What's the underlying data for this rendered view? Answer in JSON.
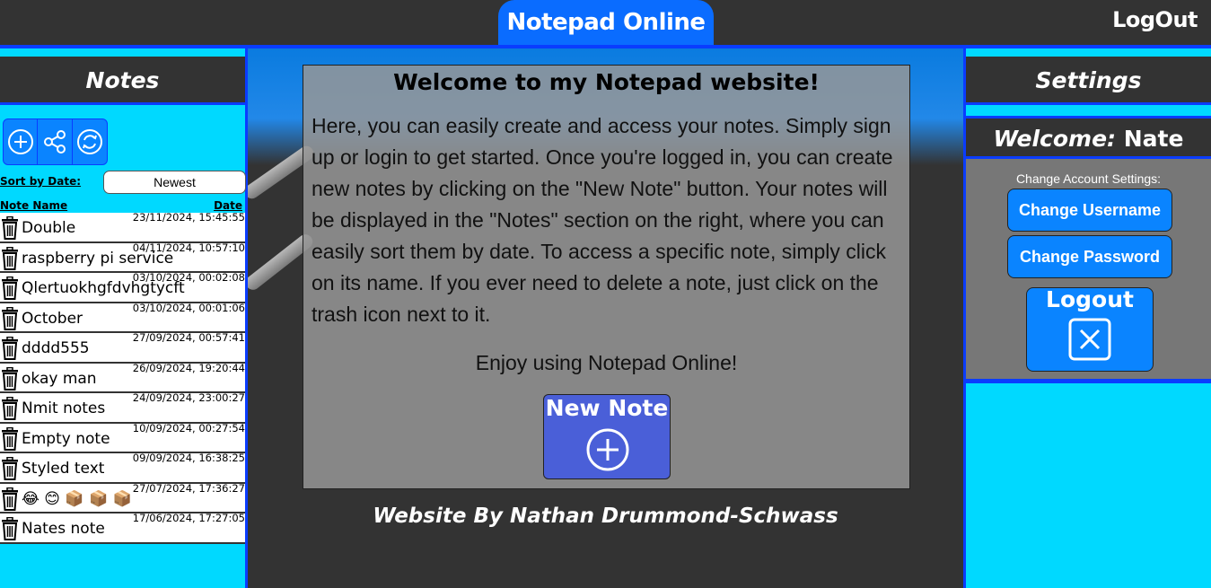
{
  "header": {
    "site_title": "Notepad Online",
    "logout_label": "LogOut"
  },
  "notes_panel": {
    "title": "Notes",
    "tools": [
      {
        "icon": "add-circle-icon"
      },
      {
        "icon": "share-icon"
      },
      {
        "icon": "refresh-icon"
      }
    ],
    "sort_label": "Sort by Date:",
    "sort_value": "Newest",
    "col_name": "Note Name",
    "col_date": "Date",
    "notes": [
      {
        "name": "Double",
        "date": "23/11/2024, 15:45:55"
      },
      {
        "name": "raspberry pi service",
        "date": "04/11/2024, 10:57:10"
      },
      {
        "name": "Qlertuokhgfdvhgtycft",
        "date": "03/10/2024, 00:02:08"
      },
      {
        "name": "October",
        "date": "03/10/2024, 00:01:06"
      },
      {
        "name": "dddd555",
        "date": "27/09/2024, 00:57:41"
      },
      {
        "name": "okay man",
        "date": "26/09/2024, 19:20:44"
      },
      {
        "name": "Nmit notes",
        "date": "24/09/2024, 23:00:27"
      },
      {
        "name": "Empty note",
        "date": "10/09/2024, 00:27:54"
      },
      {
        "name": "Styled text",
        "date": "09/09/2024, 16:38:25"
      },
      {
        "name": "😂 😊 📦 📦 📦",
        "date": "27/07/2024, 17:36:27"
      },
      {
        "name": "Nates note",
        "date": "17/06/2024, 17:27:05"
      }
    ]
  },
  "main": {
    "welcome_title": "Welcome to my Notepad website!",
    "welcome_text": "Here, you can easily create and access your notes. Simply sign up or login to get started. Once you're logged in, you can create new notes by clicking on the \"New Note\" button. Your notes will be displayed in the \"Notes\" section on the right, where you can easily sort them by date. To access a specific note, simply click on its name. If you ever need to delete a note, just click on the trash icon next to it.",
    "enjoy_text": "Enjoy using Notepad Online!",
    "new_note_label": "New Note",
    "footer": "Website By Nathan Drummond-Schwass"
  },
  "settings_panel": {
    "title": "Settings",
    "welcome_label": "Welcome:",
    "username": "Nate",
    "change_account_label": "Change Account Settings:",
    "change_username_label": "Change Username",
    "change_password_label": "Change Password",
    "logout_label": "Logout"
  },
  "colors": {
    "accent": "#0a84ff",
    "panel_cyan": "#00d9ff",
    "dark": "#333333",
    "border_blue": "#0a3cff"
  }
}
